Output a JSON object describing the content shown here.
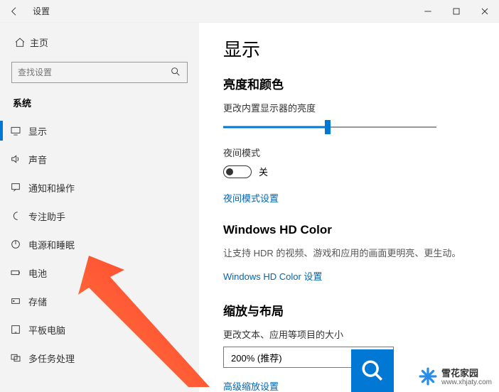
{
  "titlebar": {
    "title": "设置"
  },
  "sidebar": {
    "home": "主页",
    "search_placeholder": "查找设置",
    "group": "系统",
    "items": [
      {
        "label": "显示"
      },
      {
        "label": "声音"
      },
      {
        "label": "通知和操作"
      },
      {
        "label": "专注助手"
      },
      {
        "label": "电源和睡眠"
      },
      {
        "label": "电池"
      },
      {
        "label": "存储"
      },
      {
        "label": "平板电脑"
      },
      {
        "label": "多任务处理"
      }
    ]
  },
  "main": {
    "heading": "显示",
    "brightness": {
      "section": "亮度和颜色",
      "label": "更改内置显示器的亮度",
      "value_pct": 49
    },
    "nightlight": {
      "label": "夜间模式",
      "state": "关",
      "settings_link": "夜间模式设置"
    },
    "hdr": {
      "section": "Windows HD Color",
      "desc": "让支持 HDR 的视频、游戏和应用的画面更明亮、更生动。",
      "link": "Windows HD Color 设置"
    },
    "scale": {
      "section": "缩放与布局",
      "label": "更改文本、应用等项目的大小",
      "value": "200% (推荐)",
      "advanced_link": "高级缩放设置"
    }
  },
  "watermark": {
    "name": "雪花家园",
    "url": "www.xhjaty.com"
  }
}
